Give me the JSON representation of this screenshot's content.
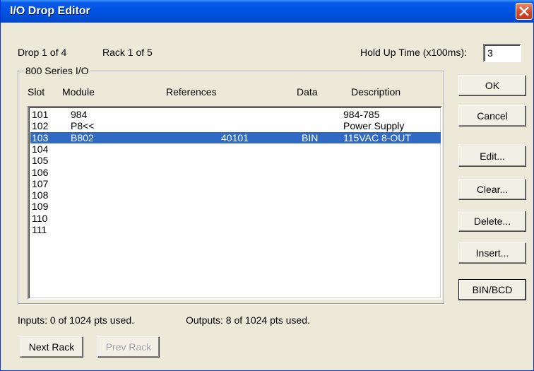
{
  "window": {
    "title": "I/O Drop Editor"
  },
  "header": {
    "drop": "Drop 1 of 4",
    "rack": "Rack 1 of 5",
    "hold_label": "Hold Up Time (x100ms):",
    "hold_value": "3"
  },
  "group": {
    "title": "800 Series I/O"
  },
  "columns": {
    "slot": "Slot",
    "module": "Module",
    "references": "References",
    "data": "Data",
    "description": "Description"
  },
  "rows": [
    {
      "slot": "101",
      "module": "984",
      "references": "",
      "data": "",
      "description": "984-785"
    },
    {
      "slot": "102",
      "module": "P8<<",
      "references": "",
      "data": "",
      "description": "Power Supply"
    },
    {
      "slot": "103",
      "module": "B802",
      "references": "40101",
      "data": "BIN",
      "description": "115VAC  8-OUT"
    },
    {
      "slot": "104",
      "module": "",
      "references": "",
      "data": "",
      "description": ""
    },
    {
      "slot": "105",
      "module": "",
      "references": "",
      "data": "",
      "description": ""
    },
    {
      "slot": "106",
      "module": "",
      "references": "",
      "data": "",
      "description": ""
    },
    {
      "slot": "107",
      "module": "",
      "references": "",
      "data": "",
      "description": ""
    },
    {
      "slot": "108",
      "module": "",
      "references": "",
      "data": "",
      "description": ""
    },
    {
      "slot": "109",
      "module": "",
      "references": "",
      "data": "",
      "description": ""
    },
    {
      "slot": "110",
      "module": "",
      "references": "",
      "data": "",
      "description": ""
    },
    {
      "slot": "111",
      "module": "",
      "references": "",
      "data": "",
      "description": ""
    }
  ],
  "selected_slot": "103",
  "buttons": {
    "ok": "OK",
    "cancel": "Cancel",
    "edit": "Edit...",
    "clear": "Clear...",
    "delete": "Delete...",
    "insert": "Insert...",
    "bin_bcd": "BIN/BCD",
    "next_rack": "Next Rack",
    "prev_rack": "Prev Rack"
  },
  "footer": {
    "inputs": "Inputs:  0 of 1024 pts used.",
    "outputs": "Outputs:  8 of 1024 pts used."
  },
  "colors": {
    "titlebar": "#0054e3",
    "selection": "#316ac5",
    "dialog_bg": "#ece9d8"
  },
  "icons": {
    "close": "close-icon"
  }
}
